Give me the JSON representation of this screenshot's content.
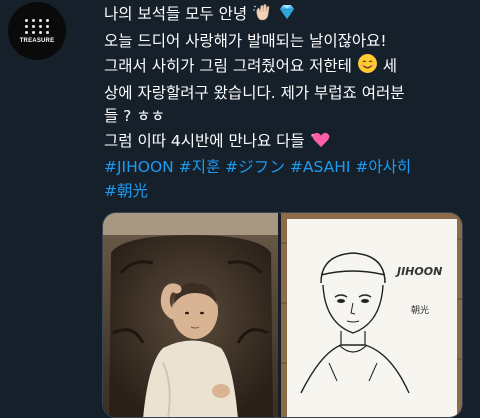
{
  "account": {
    "avatar_icon": "treasure-logo",
    "avatar_text": "TREASURE"
  },
  "tweet": {
    "line1": "나의 보석들 모두 안녕",
    "line1_emojis": [
      "waving-hand",
      "gem"
    ],
    "line2": "오늘 드디어 사랑해가 발매되는 날이잖아요!",
    "line3": "그래서 사히가 그림 그려줬어요 저한테",
    "line3_emoji": "smiling-face",
    "line3_end": " 세",
    "line4": "상에 자랑할려구 왔습니다. 제가 부럽죠 여러분",
    "line5": "들 ? ㅎㅎ",
    "line6": "그럼 이따 4시반에 만나요 다들",
    "line6_emoji": "two-hearts",
    "hashtags_line1": [
      "#JIHOON",
      "#지훈",
      "#ジフン",
      "#ASAHI",
      "#아사히"
    ],
    "hashtags_line2": [
      "#朝光"
    ]
  },
  "media": {
    "left_image": "baby-photo",
    "right_image": "pencil-drawing",
    "drawing_caption": "JIHOON",
    "drawing_signature": "朝光"
  },
  "colors": {
    "background": "#15202b",
    "hashtag": "#1d9bf0",
    "border": "#38444d"
  }
}
